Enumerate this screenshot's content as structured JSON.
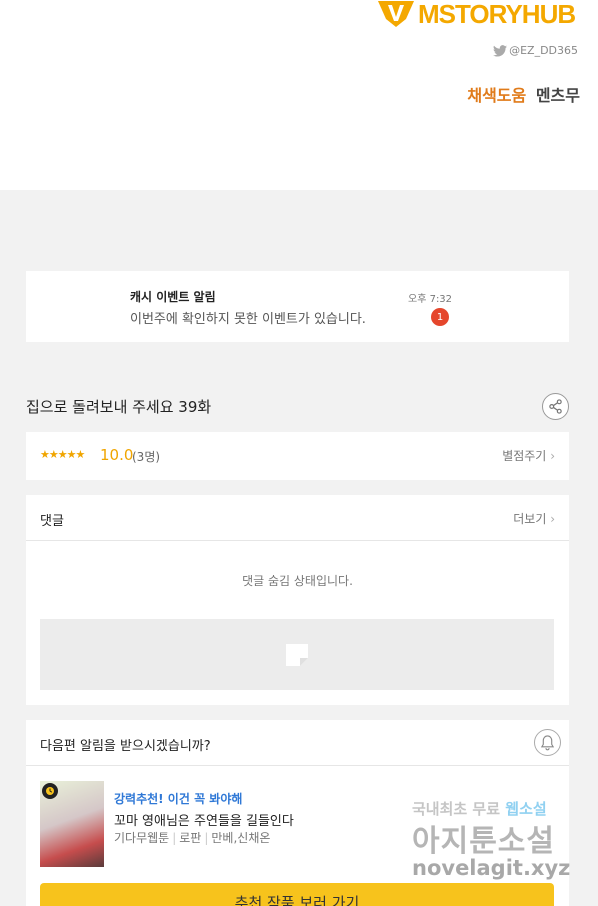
{
  "header": {
    "logo_text": "MSTORYHUB",
    "twitter_handle": "@EZ_DD365",
    "credit_label": "채색도움",
    "credit_name": "멘츠무",
    "brand_color": "#f4a800"
  },
  "notice": {
    "title": "캐시 이벤트 알림",
    "message": "이번주에 확인하지 못한 이벤트가 있습니다.",
    "time": "오후 7:32",
    "badge_count": "1"
  },
  "episode": {
    "title": "집으로 돌려보내 주세요 39화"
  },
  "rating": {
    "stars": "★★★★★",
    "score": "10.0",
    "count": "(3명)",
    "give_label": "별점주기"
  },
  "comments": {
    "label": "댓글",
    "more_label": "더보기",
    "hidden_message": "댓글 숨김 상태입니다."
  },
  "alert": {
    "question": "다음편 알림을 받으시겠습니까?"
  },
  "recommendation": {
    "tagline": "강력추천! 이건 꼭 봐야해",
    "title": "꼬마 영애님은 주연들을 길들인다",
    "genre": "기다무웹툰",
    "category": "로판",
    "authors": "만베,신채온",
    "cta_label": "추천 작품 보러 가기"
  },
  "watermark": {
    "line1": "국내최초 무료",
    "line1_highlight": "웹소설",
    "line2": "아지툰소설",
    "line3": "novelagit.xyz"
  },
  "colors": {
    "accent": "#f7c31c",
    "badge": "#e5462c",
    "link_blue": "#2f78d6",
    "star": "#f0a500"
  }
}
